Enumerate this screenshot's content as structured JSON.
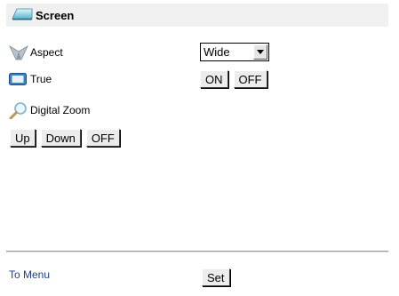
{
  "header": {
    "title": "Screen",
    "icon": "screen-icon"
  },
  "aspect": {
    "label": "Aspect",
    "icon": "aspect-icon",
    "selected": "Wide"
  },
  "true_mode": {
    "label": "True",
    "icon": "true-icon",
    "on_label": "ON",
    "off_label": "OFF"
  },
  "digital_zoom": {
    "label": "Digital Zoom",
    "icon": "magnifier-icon",
    "up_label": "Up",
    "down_label": "Down",
    "off_label": "OFF"
  },
  "footer": {
    "menu_link": "To Menu",
    "set_label": "Set"
  }
}
